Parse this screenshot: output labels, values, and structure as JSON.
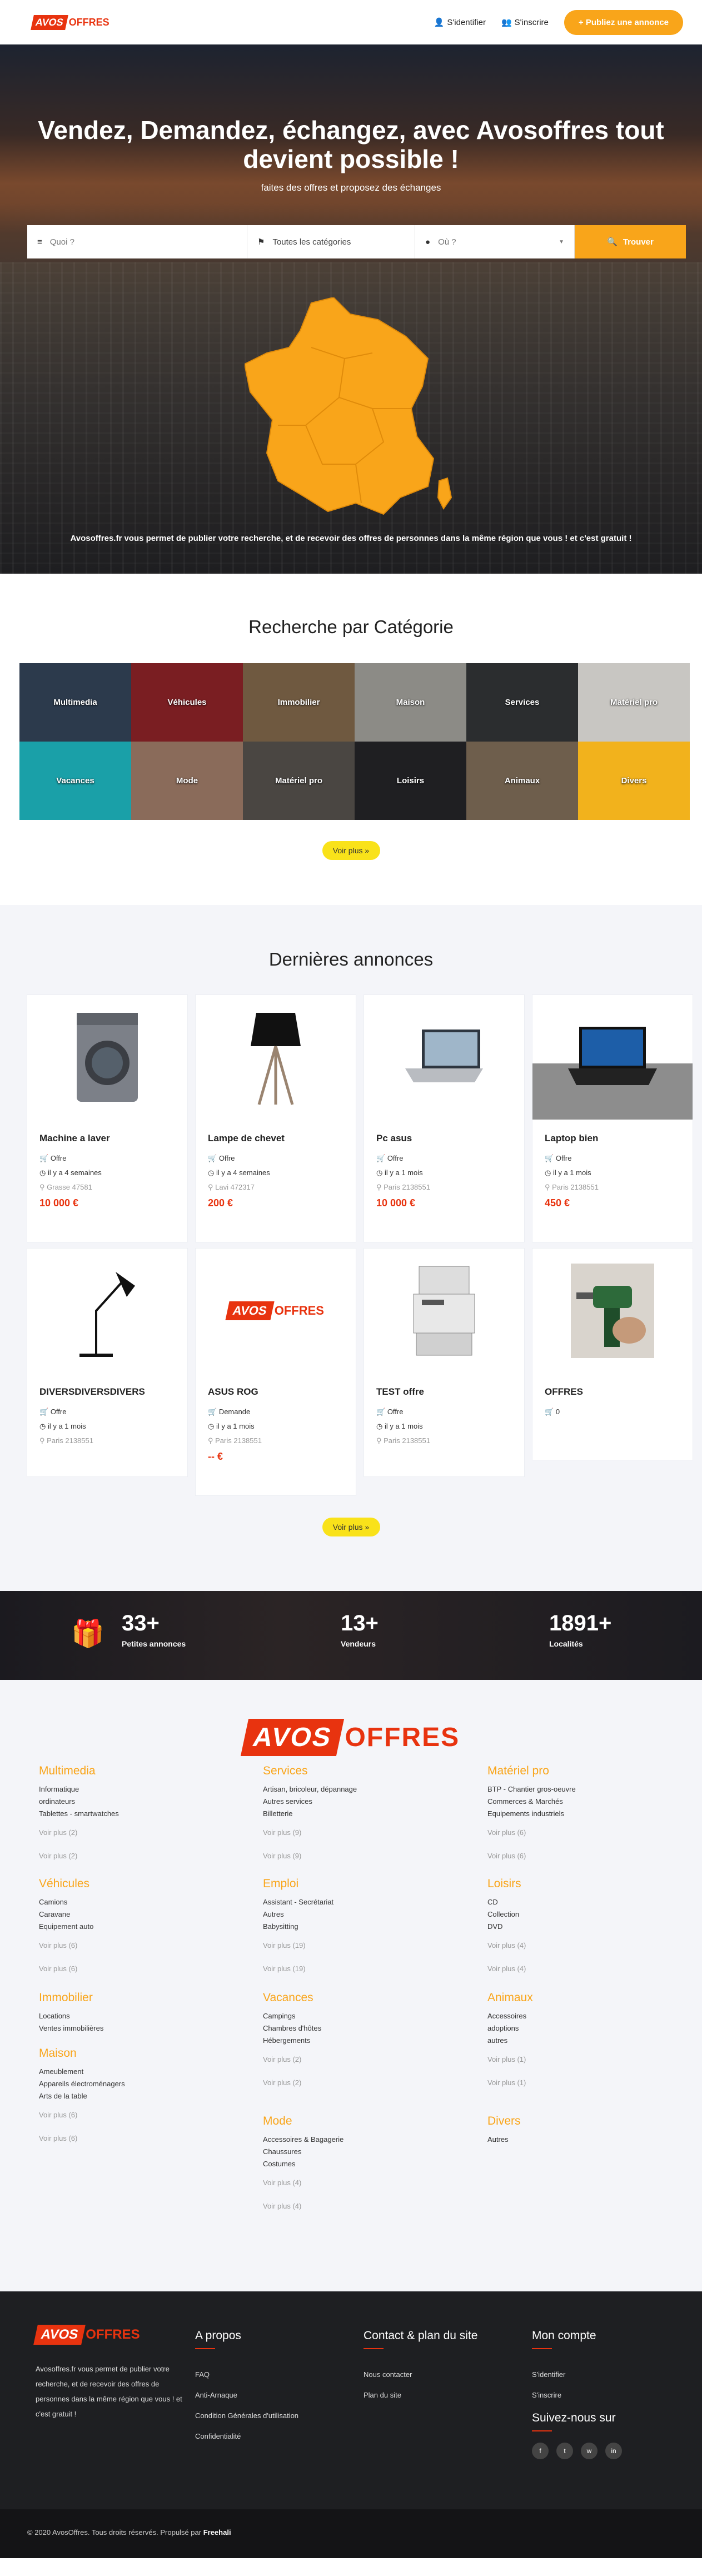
{
  "header": {
    "logo_avos": "AVOS",
    "logo_offres": "OFFRES",
    "login": "S'identifier",
    "register": "S'inscrire",
    "publish": "Publiez une annonce"
  },
  "hero": {
    "title": "Vendez, Demandez, échangez, avec Avosoffres tout devient possible !",
    "subtitle": "faites des offres et proposez des échanges",
    "search_what_placeholder": "Quoi ?",
    "search_category": "Toutes les catégories",
    "search_where_placeholder": "Où ?",
    "search_button": "Trouver",
    "note": "Avosoffres.fr vous permet de publier votre recherche, et de recevoir des offres de personnes dans la même région que vous ! et c'est gratuit !"
  },
  "categories": {
    "title": "Recherche par Catégorie",
    "items": [
      {
        "label": "Multimedia",
        "color": "#2c3a4c"
      },
      {
        "label": "Véhicules",
        "color": "#7a1e22"
      },
      {
        "label": "Immobilier",
        "color": "#6f5940"
      },
      {
        "label": "Maison",
        "color": "#8c8b86"
      },
      {
        "label": "Services",
        "color": "#2b2d2f"
      },
      {
        "label": "Matériel pro",
        "color": "#c8c6c2"
      },
      {
        "label": "Vacances",
        "color": "#1aa0a8"
      },
      {
        "label": "Mode",
        "color": "#8a6b5a"
      },
      {
        "label": "Matériel pro",
        "color": "#4a4642"
      },
      {
        "label": "Loisirs",
        "color": "#1f1f22"
      },
      {
        "label": "Animaux",
        "color": "#6e5e4c"
      },
      {
        "label": "Divers",
        "color": "#f2b21c"
      }
    ],
    "more": "Voir plus"
  },
  "ads": {
    "title": "Dernières annonces",
    "items": [
      {
        "title": "Machine a laver",
        "type": "Offre",
        "time": "il y a 4 semaines",
        "place": "Grasse 47581",
        "price": "10 000 €",
        "icon": "washing-machine-icon"
      },
      {
        "title": "Lampe de chevet",
        "type": "Offre",
        "time": "il y a 4 semaines",
        "place": "Lavi 472317",
        "price": "200 €",
        "icon": "lamp-icon"
      },
      {
        "title": "Pc asus",
        "type": "Offre",
        "time": "il y a 1 mois",
        "place": "Paris 2138551",
        "price": "10 000 €",
        "icon": "laptop-icon"
      },
      {
        "title": "Laptop bien",
        "type": "Offre",
        "time": "il y a 1 mois",
        "place": "Paris 2138551",
        "price": "450 €",
        "icon": "gaming-laptop-icon"
      },
      {
        "title": "DIVERSDIVERSDIVERS",
        "type": "Offre",
        "time": "il y a 1 mois",
        "place": "Paris 2138551",
        "price": "",
        "icon": "desk-lamp-icon"
      },
      {
        "title": "ASUS ROG",
        "type": "Demande",
        "time": "il y a 1 mois",
        "place": "Paris 2138551",
        "price": "-- €",
        "icon": "avosoffres-logo"
      },
      {
        "title": "TEST offre",
        "type": "Offre",
        "time": "il y a 1 mois",
        "place": "Paris 2138551",
        "price": "",
        "icon": "printer-icon"
      },
      {
        "title": "OFFRES",
        "type": "0",
        "time": "",
        "place": "",
        "price": "",
        "icon": "drill-icon"
      }
    ],
    "more": "Voir plus"
  },
  "stats": [
    {
      "number": "33+",
      "label": "Petites annonces"
    },
    {
      "number": "13+",
      "label": "Vendeurs"
    },
    {
      "number": "1891+",
      "label": "Localités"
    }
  ],
  "clist": {
    "logo_avos": "AVOS",
    "logo_offres": "OFFRES",
    "groups": [
      {
        "title": "Multimedia",
        "items": [
          "Informatique",
          "ordinateurs",
          "Tablettes - smartwatches"
        ],
        "more": "Voir plus (2)",
        "more2": "Voir plus (2)"
      },
      {
        "title": "Services",
        "items": [
          "Artisan, bricoleur, dépannage",
          "Autres services",
          "Billetterie"
        ],
        "more": "Voir plus (9)",
        "more2": "Voir plus (9)"
      },
      {
        "title": "Matériel pro",
        "items": [
          "BTP - Chantier gros-oeuvre",
          "Commerces & Marchés",
          "Equipements industriels"
        ],
        "more": "Voir plus (6)",
        "more2": "Voir plus (6)"
      },
      {
        "title": "Véhicules",
        "items": [
          "Camions",
          "Caravane",
          "Equipement auto"
        ],
        "more": "Voir plus (6)",
        "more2": "Voir plus (6)"
      },
      {
        "title": "Emploi",
        "items": [
          "Assistant - Secrétariat",
          "Autres",
          "Babysitting"
        ],
        "more": "Voir plus (19)",
        "more2": "Voir plus (19)"
      },
      {
        "title": "Loisirs",
        "items": [
          "CD",
          "Collection",
          "DVD"
        ],
        "more": "Voir plus (4)",
        "more2": "Voir plus (4)"
      },
      {
        "title": "Immobilier",
        "items": [
          "Locations",
          "Ventes immobilières"
        ],
        "more": "",
        "more2": ""
      },
      {
        "title": "Vacances",
        "items": [
          "Campings",
          "Chambres d'hôtes",
          "Hébergements"
        ],
        "more": "Voir plus (2)",
        "more2": "Voir plus (2)"
      },
      {
        "title": "Animaux",
        "items": [
          "Accessoires",
          "adoptions",
          "autres"
        ],
        "more": "Voir plus (1)",
        "more2": "Voir plus (1)"
      },
      {
        "title": "Maison",
        "items": [
          "Ameublement",
          "Appareils électroménagers",
          "Arts de la table"
        ],
        "more": "Voir plus (6)",
        "more2": "Voir plus (6)"
      },
      {
        "title": "Mode",
        "items": [
          "Accessoires & Bagagerie",
          "Chaussures",
          "Costumes"
        ],
        "more": "Voir plus (4)",
        "more2": "Voir plus (4)"
      },
      {
        "title": "Divers",
        "items": [
          "Autres"
        ],
        "more": "",
        "more2": ""
      }
    ]
  },
  "footer": {
    "logo_avos": "AVOS",
    "logo_offres": "OFFRES",
    "desc": "Avosoffres.fr vous permet de publier votre recherche, et de recevoir des offres de personnes dans la même région que vous ! et c'est gratuit !",
    "about_title": "A propos",
    "about": [
      "FAQ",
      "Anti-Arnaque",
      "Condition Générales d'utilisation",
      "Confidentialité"
    ],
    "contact_title": "Contact & plan du site",
    "contact": [
      "Nous contacter",
      "Plan du site"
    ],
    "account_title": "Mon compte",
    "account": [
      "S'identifier",
      "S'inscrire"
    ],
    "follow_title": "Suivez-nous sur",
    "copyright": "© 2020 AvosOffres. Tous droits réservés. Propulsé par",
    "powered": "Freehali"
  },
  "colors": {
    "brand": "#e8330f",
    "accent": "#f9a51a"
  }
}
